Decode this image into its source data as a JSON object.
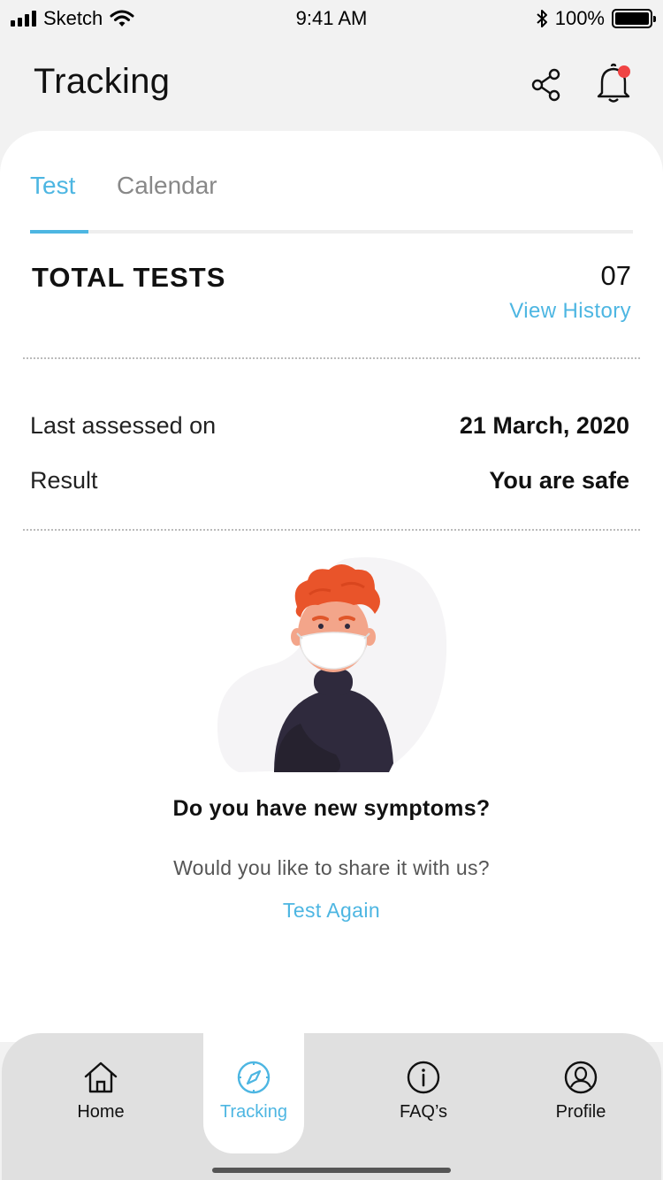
{
  "status_bar": {
    "carrier": "Sketch",
    "time": "9:41 AM",
    "battery": "100%",
    "icons": [
      "signal-icon",
      "wifi-icon",
      "bluetooth-icon",
      "battery-icon"
    ]
  },
  "header": {
    "title": "Tracking",
    "share_icon": "share-icon",
    "notification_icon": "bell-icon",
    "notification_badge_color": "#f04444"
  },
  "tabs": {
    "items": [
      {
        "label": "Test",
        "active": true
      },
      {
        "label": "Calendar",
        "active": false
      }
    ]
  },
  "summary": {
    "total_label": "TOTAL TESTS",
    "total_value": "07",
    "history_link": "View History"
  },
  "details": {
    "rows": [
      {
        "label": "Last assessed on",
        "value": "21 March, 2020"
      },
      {
        "label": "Result",
        "value": "You are safe"
      }
    ]
  },
  "prompt": {
    "title": "Do you have new symptoms?",
    "subtitle": "Would you like to share it with us?",
    "action": "Test Again"
  },
  "bottom_nav": {
    "items": [
      {
        "label": "Home",
        "icon": "home-icon",
        "active": false
      },
      {
        "label": "Tracking",
        "icon": "compass-icon",
        "active": true
      },
      {
        "label": "FAQ’s",
        "icon": "info-icon",
        "active": false
      },
      {
        "label": "Profile",
        "icon": "user-icon",
        "active": false
      }
    ]
  },
  "colors": {
    "accent": "#4db6e2",
    "background": "#f2f2f2",
    "card": "#ffffff",
    "nav_background": "#e0e0e0"
  }
}
